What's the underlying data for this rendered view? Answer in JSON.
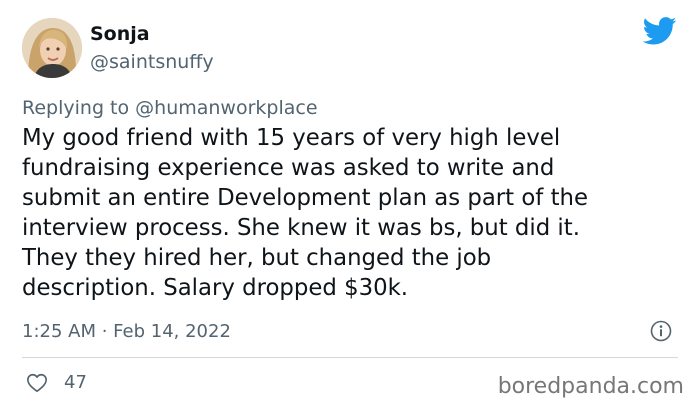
{
  "tweet": {
    "display_name": "Sonja",
    "handle": "@saintsnuffy",
    "replying_prefix": "Replying to ",
    "replying_to": "@humanworkplace",
    "text": "My good friend with 15 years of very high level\nfundraising experience was asked to write and\nsubmit an entire Development plan as part of the\ninterview process. She knew it was bs, but did it.\nThey they hired her, but changed the job\ndescription. Salary dropped $30k.",
    "timestamp": "1:25 AM · Feb 14, 2022",
    "like_count": "47"
  },
  "watermark": "boredpanda.com",
  "icons": {
    "brand": "twitter-bird-icon",
    "info": "info-icon",
    "like": "heart-icon"
  },
  "colors": {
    "twitter_blue": "#1d9bf0",
    "text_primary": "#0f1419",
    "text_secondary": "#536471",
    "divider": "#cfd9de"
  }
}
